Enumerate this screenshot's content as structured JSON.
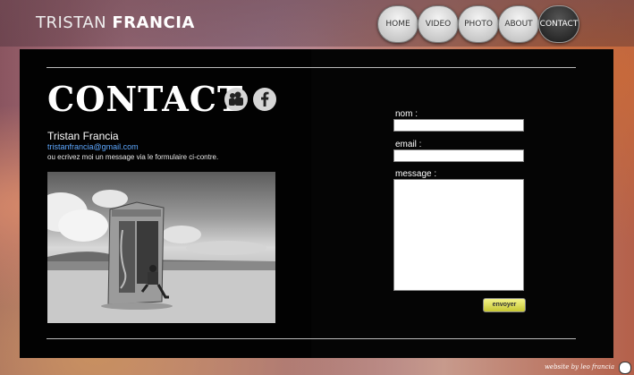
{
  "header": {
    "brand_first": "TRISTAN",
    "brand_last": "FRANCIA",
    "nav": [
      {
        "label": "HOME"
      },
      {
        "label": "VIDEO"
      },
      {
        "label": "PHOTO"
      },
      {
        "label": "ABOUT"
      },
      {
        "label": "CONTACT",
        "active": true
      }
    ]
  },
  "contact": {
    "title": "CONTACT",
    "social_icons": [
      "myspace-icon",
      "facebook-icon"
    ],
    "name": "Tristan Francia",
    "email": "tristanfrancia@gmail.com",
    "text": "ou ecrivez moi un message via le formulaire ci-contre."
  },
  "form": {
    "name_label": "nom :",
    "email_label": "email :",
    "message_label": "message :",
    "submit_label": "envoyer"
  },
  "footer": {
    "credit": "website by leo francia"
  },
  "colors": {
    "link": "#5ea8ff",
    "button": "#e0e04a",
    "panel": "#050505"
  }
}
